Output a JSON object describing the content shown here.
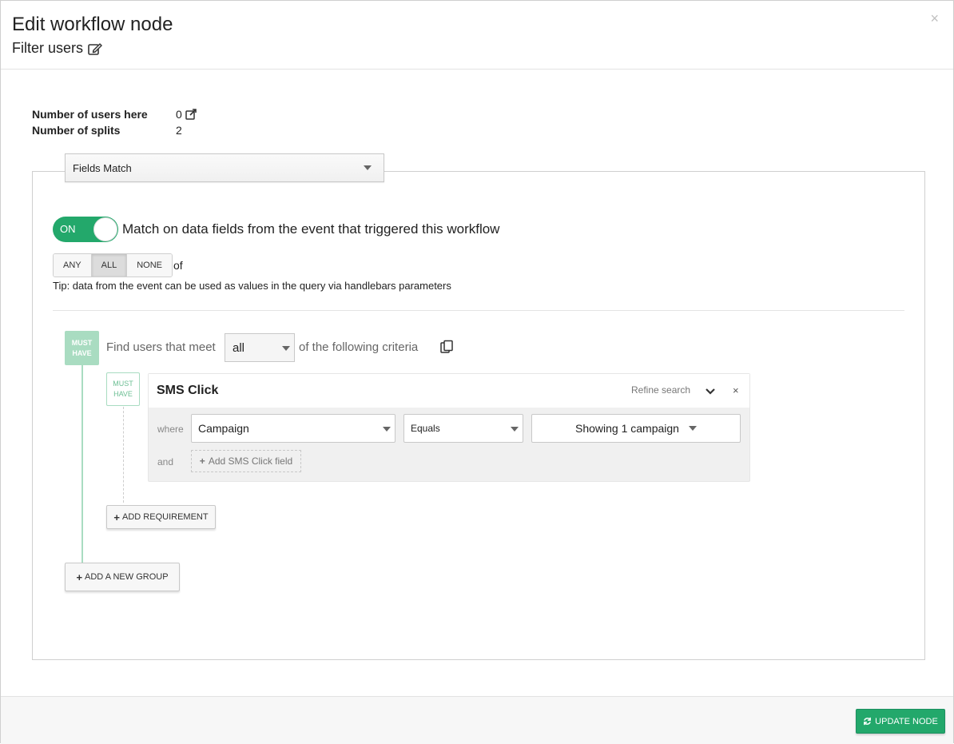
{
  "header": {
    "title": "Edit workflow node",
    "subtitle": "Filter users",
    "close_label": "×"
  },
  "stats": {
    "users_label": "Number of users here",
    "users_value": "0",
    "splits_label": "Number of splits",
    "splits_value": "2"
  },
  "filter_type": {
    "selected": "Fields Match"
  },
  "toggle": {
    "label": "ON",
    "state": "on",
    "description": "Match on data fields from the event that triggered this workflow"
  },
  "match_mode": {
    "options": [
      "ANY",
      "ALL",
      "NONE"
    ],
    "selected": "ALL",
    "suffix": "of"
  },
  "tip": "Tip: data from the event can be used as values in the query via handlebars parameters",
  "group": {
    "badge_line1": "MUST",
    "badge_line2": "HAVE",
    "find_prefix": "Find users that meet",
    "quantifier": "all",
    "find_suffix": "of the following criteria"
  },
  "criterion": {
    "badge_line1": "MUST",
    "badge_line2": "HAVE",
    "title": "SMS Click",
    "refine_label": "Refine search",
    "close_label": "×",
    "where_label": "where",
    "field": "Campaign",
    "operator": "Equals",
    "value": "Showing 1 campaign",
    "and_label": "and",
    "add_field_label": "Add SMS Click field"
  },
  "buttons": {
    "add_requirement": "ADD REQUIREMENT",
    "add_group": "ADD A NEW GROUP",
    "update_node": "UPDATE NODE"
  },
  "colors": {
    "accent_green": "#23a86b",
    "badge_green": "#a9dcc1"
  }
}
